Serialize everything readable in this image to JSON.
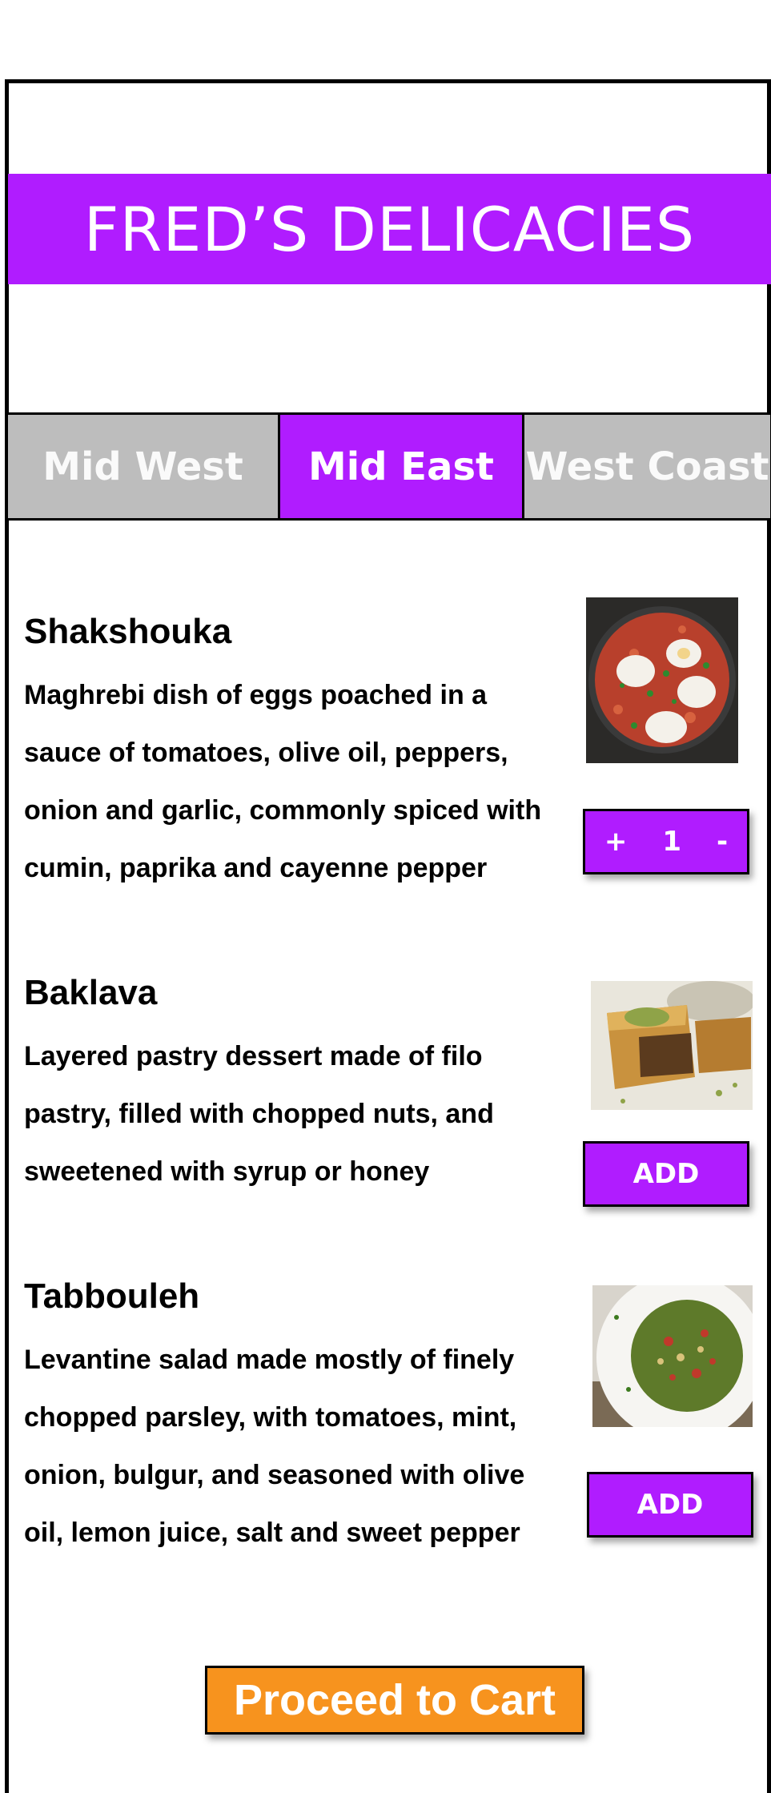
{
  "brand": {
    "title": "FRED’S DELICACIES"
  },
  "tabs": [
    {
      "label": "Mid West"
    },
    {
      "label": "Mid East"
    },
    {
      "label": "West Coast"
    }
  ],
  "items": [
    {
      "name": "Shakshouka",
      "description": "Maghrebi dish of eggs poached in a sauce of tomatoes, olive oil, peppers, onion and garlic, commonly spiced with cumin, paprika and cayenne pepper",
      "quantity": {
        "plus": "+",
        "value": "1",
        "minus": "-"
      }
    },
    {
      "name": "Baklava",
      "description": "Layered pastry dessert made of filo pastry, filled with chopped nuts, and sweetened with syrup or honey",
      "button": "ADD"
    },
    {
      "name": "Tabbouleh",
      "description": "Levantine salad made mostly of finely chopped parsley, with tomatoes, mint, onion, bulgur, and seasoned with olive oil, lemon juice, salt and sweet pepper",
      "button": "ADD"
    }
  ],
  "cart": {
    "label": "Proceed to Cart"
  },
  "colors": {
    "accent": "#b01cff",
    "tab_inactive": "#bdbdbd",
    "cart": "#f7931e"
  }
}
